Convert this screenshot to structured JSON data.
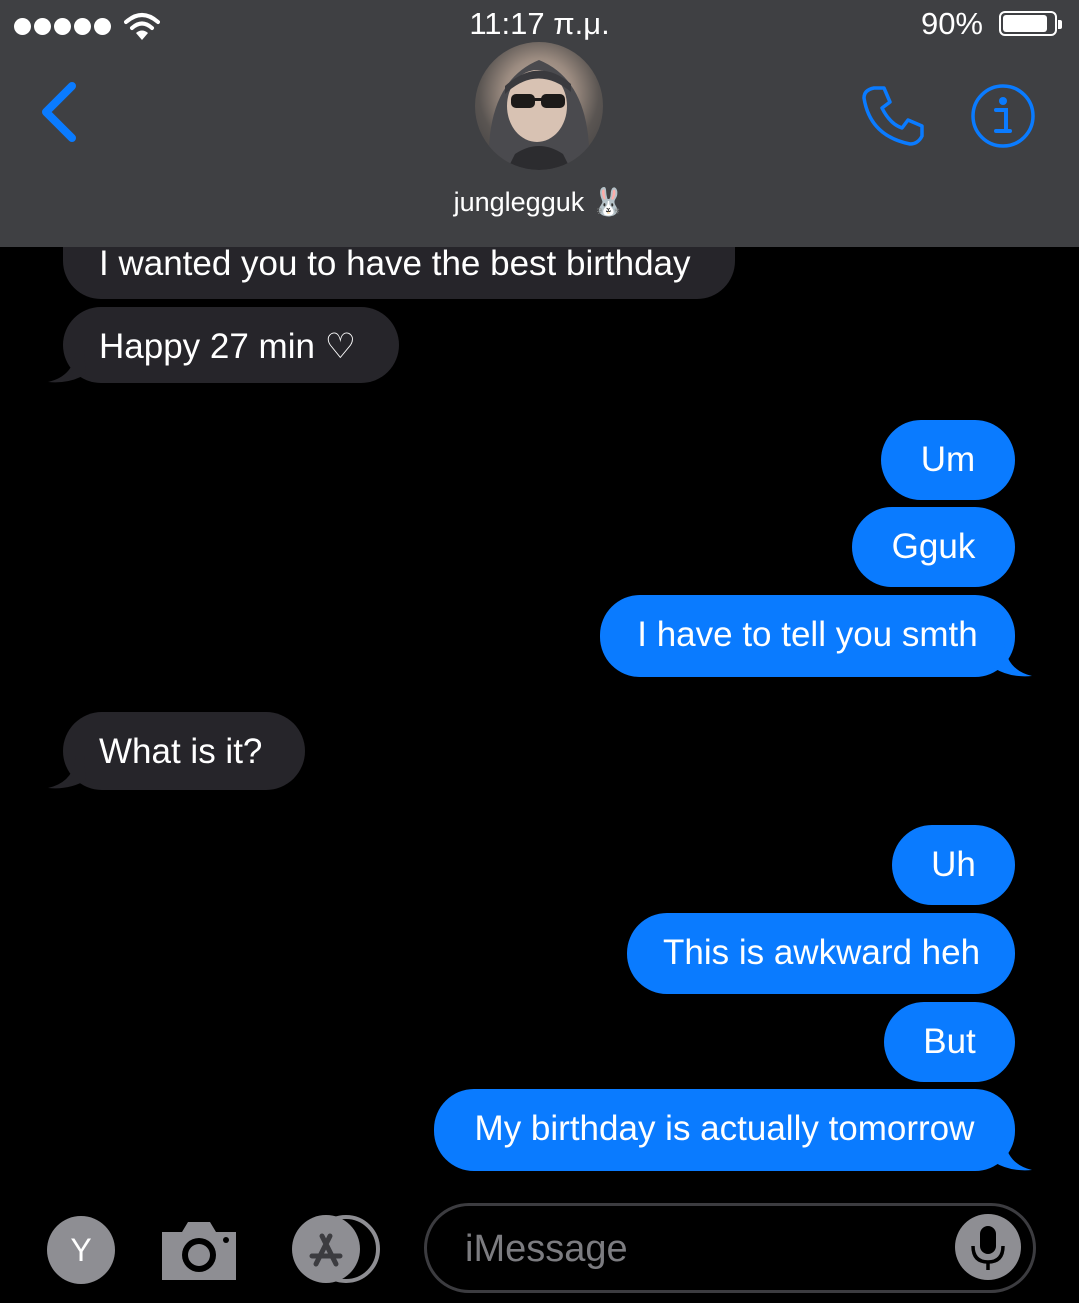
{
  "status_bar": {
    "time": "11:17 π.μ.",
    "battery_percent": "90%",
    "battery_level": 0.9,
    "signal_dots": 5
  },
  "header": {
    "contact_name": "junglegguk 🐰",
    "accent_color": "#0a7bff"
  },
  "messages": [
    {
      "from": "them",
      "text": "I wanted you to have the best birthday"
    },
    {
      "from": "them",
      "text": "Happy 27 min ♡"
    },
    {
      "from": "me",
      "text": "Um"
    },
    {
      "from": "me",
      "text": "Gguk"
    },
    {
      "from": "me",
      "text": "I have to tell you smth"
    },
    {
      "from": "them",
      "text": "What is it?"
    },
    {
      "from": "me",
      "text": "Uh"
    },
    {
      "from": "me",
      "text": "This is awkward heh"
    },
    {
      "from": "me",
      "text": "But"
    },
    {
      "from": "me",
      "text": "My birthday is actually tomorrow"
    }
  ],
  "input_bar": {
    "apps_button_label": "Y",
    "placeholder": "iMessage"
  },
  "icons": [
    "back-chevron-icon",
    "phone-icon",
    "info-icon",
    "camera-icon",
    "app-store-icon",
    "microphone-icon",
    "wifi-icon",
    "battery-icon"
  ]
}
